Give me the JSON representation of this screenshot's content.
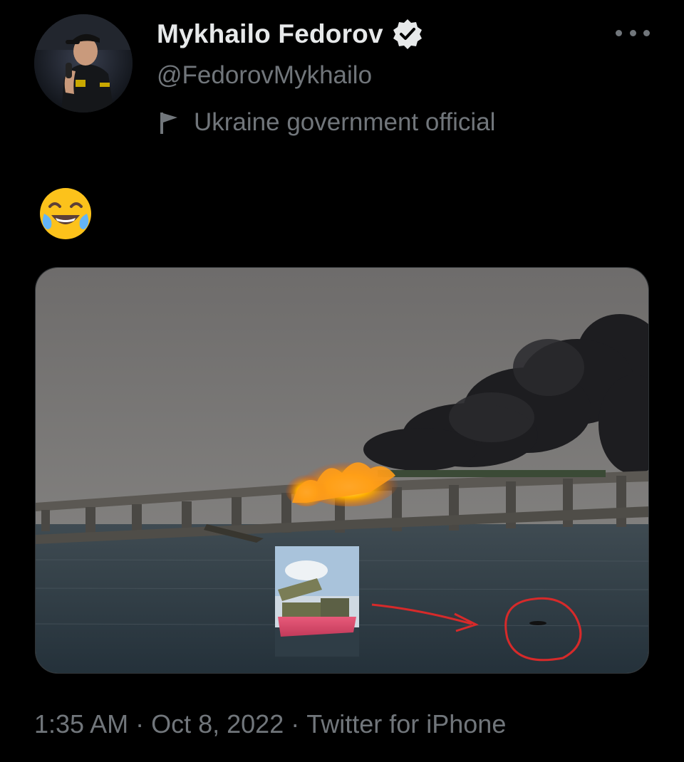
{
  "author": {
    "name": "Mykhailo Fedorov",
    "handle": "@FedorovMykhailo",
    "verified_icon": "verified-badge-icon",
    "label_icon": "flag-icon",
    "label": "Ukraine government official"
  },
  "menu_icon": "more-options-icon",
  "tweet": {
    "emoji": "😂",
    "media_description_icon": "photo"
  },
  "meta": {
    "time": "1:35 AM",
    "separator": " · ",
    "date": "Oct 8, 2022",
    "source": "Twitter for iPhone"
  },
  "colors": {
    "background": "#000000",
    "text_primary": "#e7e9ea",
    "text_secondary": "#71767b",
    "border": "#2f3336"
  }
}
